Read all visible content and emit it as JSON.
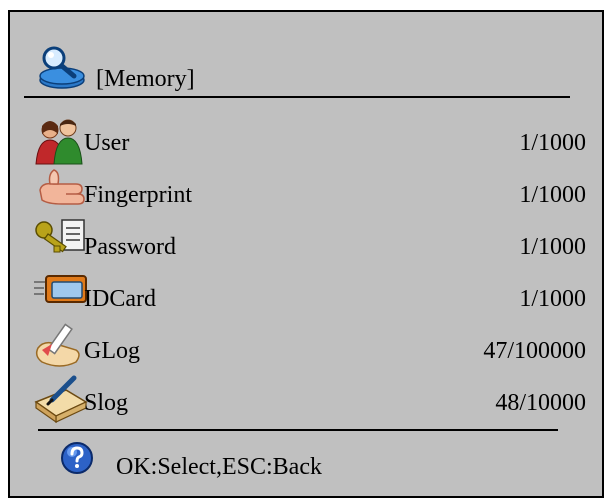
{
  "header": {
    "title": "[Memory]",
    "icon": "magnifier-disk-icon"
  },
  "rows": [
    {
      "label": "User",
      "value": "1/1000",
      "icon": "users-icon"
    },
    {
      "label": "Fingerprint",
      "value": "1/1000",
      "icon": "thumb-icon"
    },
    {
      "label": "Password",
      "value": "1/1000",
      "icon": "keys-icon"
    },
    {
      "label": "IDCard",
      "value": "1/1000",
      "icon": "id-card-icon"
    },
    {
      "label": "GLog",
      "value": "47/100000",
      "icon": "pencil-note-icon"
    },
    {
      "label": "Slog",
      "value": "48/10000",
      "icon": "pen-book-icon"
    }
  ],
  "footer": {
    "hint": "OK:Select,ESC:Back",
    "icon": "help-icon"
  }
}
